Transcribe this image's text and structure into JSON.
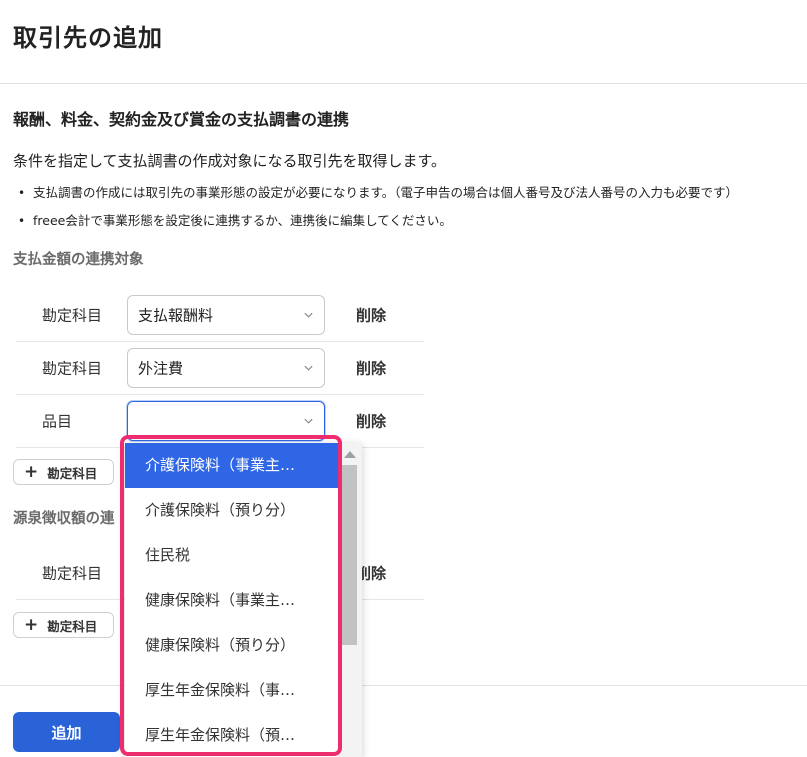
{
  "page": {
    "title": "取引先の追加"
  },
  "section": {
    "title": "報酬、料金、契約金及び賞金の支払調書の連携",
    "description": "条件を指定して支払調書の作成対象になる取引先を取得します。",
    "bullets": [
      "支払調書の作成には取引先の事業形態の設定が必要になります。（電子申告の場合は個人番号及び法人番号の入力も必要です）",
      "freee会計で事業形態を設定後に連携するか、連携後に編集してください。"
    ]
  },
  "payment_group": {
    "label": "支払金額の連携対象",
    "rows": [
      {
        "label": "勘定科目",
        "value": "支払報酬料",
        "delete": "削除"
      },
      {
        "label": "勘定科目",
        "value": "外注費",
        "delete": "削除"
      },
      {
        "label": "品目",
        "value": "",
        "delete": "削除"
      }
    ],
    "add_label": "勘定科目"
  },
  "withholding_group": {
    "label": "源泉徴収額の連携対象",
    "label_visible": "源泉徴収額の連",
    "rows": [
      {
        "label": "勘定科目",
        "value": "",
        "delete": "削除"
      }
    ],
    "add_label": "勘定科目"
  },
  "dropdown": {
    "options": [
      "介護保険料（事業主…",
      "介護保険料（預り分）",
      "住民税",
      "健康保険料（事業主…",
      "健康保険料（預り分）",
      "厚生年金保険料（事…",
      "厚生年金保険料（預…"
    ],
    "selected_index": 0
  },
  "footer": {
    "submit_label": "追加"
  },
  "colors": {
    "primary": "#2a63d8",
    "selected": "#2f66e6",
    "highlight": "#ee2c70"
  },
  "icons": {
    "select_chevron": "chevron-down-icon",
    "add": "plus-icon",
    "scroll_up": "scroll-up-icon"
  }
}
